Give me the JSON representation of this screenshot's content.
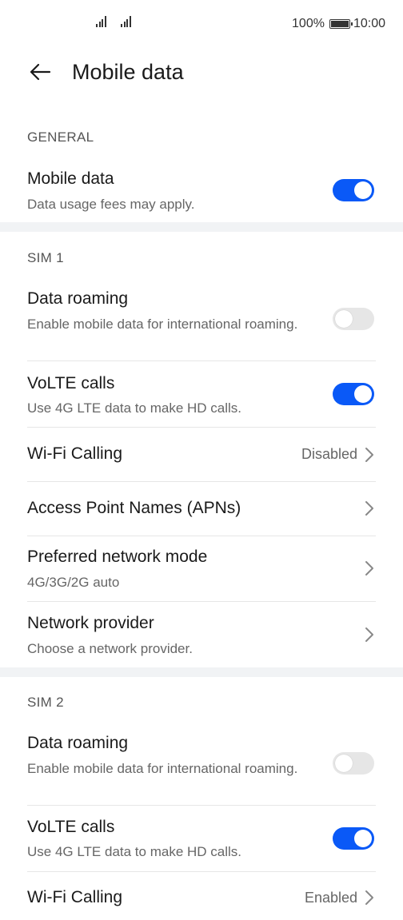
{
  "status_bar": {
    "battery": "100%",
    "time": "10:00"
  },
  "header": {
    "title": "Mobile data"
  },
  "general": {
    "header": "GENERAL",
    "mobile_data": {
      "title": "Mobile data",
      "subtitle": "Data usage fees may apply.",
      "enabled": true
    }
  },
  "sim1": {
    "header": "SIM 1",
    "data_roaming": {
      "title": "Data roaming",
      "subtitle": "Enable mobile data for international roaming.",
      "enabled": false
    },
    "volte": {
      "title": "VoLTE calls",
      "subtitle": "Use 4G LTE data to make HD calls.",
      "enabled": true
    },
    "wifi_calling": {
      "title": "Wi-Fi Calling",
      "value": "Disabled"
    },
    "apns": {
      "title": "Access Point Names (APNs)"
    },
    "preferred_network": {
      "title": "Preferred network mode",
      "subtitle": "4G/3G/2G auto"
    },
    "network_provider": {
      "title": "Network provider",
      "subtitle": "Choose a network provider."
    }
  },
  "sim2": {
    "header": "SIM 2",
    "data_roaming": {
      "title": "Data roaming",
      "subtitle": "Enable mobile data for international roaming.",
      "enabled": false
    },
    "volte": {
      "title": "VoLTE calls",
      "subtitle": "Use 4G LTE data to make HD calls.",
      "enabled": true
    },
    "wifi_calling": {
      "title": "Wi-Fi Calling",
      "value": "Enabled"
    }
  },
  "colors": {
    "accent": "#0a59f7",
    "toggle_off": "#e6e6e6",
    "band": "#f1f3f5"
  }
}
